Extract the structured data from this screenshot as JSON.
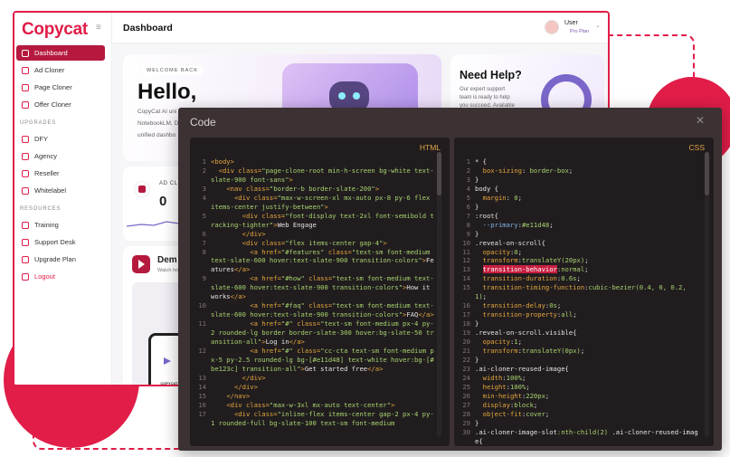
{
  "brand": {
    "name": "Copycat",
    "accent": "#e11d48",
    "active_bg": "#b51a3e"
  },
  "sidebar": {
    "items": [
      {
        "label": "Dashboard",
        "active": true
      },
      {
        "label": "Ad Cloner"
      },
      {
        "label": "Page Cloner"
      },
      {
        "label": "Offer Cloner"
      }
    ],
    "upgrades_title": "UPGRADES",
    "upgrades": [
      {
        "label": "DFY"
      },
      {
        "label": "Agency"
      },
      {
        "label": "Reseller"
      },
      {
        "label": "Whitelabel"
      }
    ],
    "resources_title": "RESOURCES",
    "resources": [
      {
        "label": "Training"
      },
      {
        "label": "Support Desk"
      },
      {
        "label": "Upgrade Plan"
      },
      {
        "label": "Logout"
      }
    ]
  },
  "header": {
    "title": "Dashboard",
    "user_name": "User",
    "user_plan": "Pro Plan"
  },
  "hero": {
    "badge": "WELCOME BACK",
    "title": "Hello,",
    "line1": "CopyCat AI uni",
    "line2": "NotebookLM, D",
    "line3": "unified dashbo"
  },
  "help": {
    "title": "Need Help?",
    "line1": "Our expert support",
    "line2": "team is ready to help",
    "line3": "you succeed. Available"
  },
  "ad_card": {
    "label": "AD CL",
    "count": "0"
  },
  "demo": {
    "title": "Dem",
    "subtitle": "Watch ho",
    "phone_brand": "COPYCAT"
  },
  "modal": {
    "title": "Code",
    "close": "✕",
    "html_label": "HTML",
    "css_label": "CSS",
    "html_lines": [
      {
        "n": "1",
        "html": "<span class='tag'>&lt;body&gt;</span>"
      },
      {
        "n": "2",
        "html": "  <span class='tag'>&lt;div</span> <span class='attr'>class=</span><span class='str'>\"page-clone-root min-h-screen bg-white text-slate-900 font-sans\"</span><span class='tag'>&gt;</span>"
      },
      {
        "n": "3",
        "html": "    <span class='tag'>&lt;nav</span> <span class='attr'>class=</span><span class='str'>\"border-b border-slate-200\"</span><span class='tag'>&gt;</span>"
      },
      {
        "n": "4",
        "html": "      <span class='tag'>&lt;div</span> <span class='attr'>class=</span><span class='str'>\"max-w-screen-xl mx-auto px-8 py-6 flex items-center justify-between\"</span><span class='tag'>&gt;</span>"
      },
      {
        "n": "5",
        "html": "        <span class='tag'>&lt;div</span> <span class='attr'>class=</span><span class='str'>\"font-display text-2xl font-semibold tracking-tighter\"</span><span class='tag'>&gt;</span><span class='txt'>Web Engage</span>"
      },
      {
        "n": "6",
        "html": "        <span class='tag'>&lt;/div&gt;</span>"
      },
      {
        "n": "7",
        "html": "        <span class='tag'>&lt;div</span> <span class='attr'>class=</span><span class='str'>\"flex items-center gap-4\"</span><span class='tag'>&gt;</span>"
      },
      {
        "n": "8",
        "html": "          <span class='tag'>&lt;a</span> <span class='attr'>href=</span><span class='str'>\"#features\"</span> <span class='attr'>class=</span><span class='str'>\"text-sm font-medium text-slate-600 hover:text-slate-900 transition-colors\"</span><span class='tag'>&gt;</span><span class='txt'>Features</span><span class='tag'>&lt;/a&gt;</span>"
      },
      {
        "n": "9",
        "html": "          <span class='tag'>&lt;a</span> <span class='attr'>href=</span><span class='str'>\"#how\"</span> <span class='attr'>class=</span><span class='str'>\"text-sm font-medium text-slate-600 hover:text-slate-900 transition-colors\"</span><span class='tag'>&gt;</span><span class='txt'>How it works</span><span class='tag'>&lt;/a&gt;</span>"
      },
      {
        "n": "10",
        "html": "          <span class='tag'>&lt;a</span> <span class='attr'>href=</span><span class='str'>\"#faq\"</span> <span class='attr'>class=</span><span class='str'>\"text-sm font-medium text-slate-600 hover:text-slate-900 transition-colors\"</span><span class='tag'>&gt;</span><span class='txt'>FAQ</span><span class='tag'>&lt;/a&gt;</span>"
      },
      {
        "n": "11",
        "html": "          <span class='tag'>&lt;a</span> <span class='attr'>href=</span><span class='str'>\"#\"</span> <span class='attr'>class=</span><span class='str'>\"text-sm font-medium px-4 py-2 rounded-lg border border-slate-300 hover:bg-slate-50 transition-all\"</span><span class='tag'>&gt;</span><span class='txt'>Log in</span><span class='tag'>&lt;/a&gt;</span>"
      },
      {
        "n": "12",
        "html": "          <span class='tag'>&lt;a</span> <span class='attr'>href=</span><span class='str'>\"#\"</span> <span class='attr'>class=</span><span class='str'>\"cc-cta text-sm font-medium px-5 py-2.5 rounded-lg bg-[#e11d48] text-white hover:bg-[#be123c] transition-all\"</span><span class='tag'>&gt;</span><span class='txt'>Get started free</span><span class='tag'>&lt;/a&gt;</span>"
      },
      {
        "n": "13",
        "html": "        <span class='tag'>&lt;/div&gt;</span>"
      },
      {
        "n": "14",
        "html": "      <span class='tag'>&lt;/div&gt;</span>"
      },
      {
        "n": "15",
        "html": "    <span class='tag'>&lt;/nav&gt;</span>"
      },
      {
        "n": "16",
        "html": "    <span class='tag'>&lt;div</span> <span class='attr'>class=</span><span class='str'>\"max-w-3xl mx-auto text-center\"</span><span class='tag'>&gt;</span>"
      },
      {
        "n": "17",
        "html": "      <span class='tag'>&lt;div</span> <span class='attr'>class=</span><span class='str'>\"inline-flex items-center gap-2 px-4 py-1 rounded-full bg-slate-100 text-sm font-medium</span>"
      }
    ],
    "css_lines": [
      {
        "n": "1",
        "html": "<span class='sel'>* {</span>"
      },
      {
        "n": "2",
        "html": "  <span class='prop'>box-sizing</span><span class='punc'>: </span><span class='val'>border-box</span><span class='punc'>;</span>"
      },
      {
        "n": "3",
        "html": "<span class='punc'>}</span>"
      },
      {
        "n": "4",
        "html": "<span class='sel'>body {</span>"
      },
      {
        "n": "5",
        "html": "  <span class='prop'>margin</span><span class='punc'>: </span><span class='val'>0</span><span class='punc'>;</span>"
      },
      {
        "n": "6",
        "html": "<span class='punc'>}</span>"
      },
      {
        "n": "7",
        "html": "<span class='sel'>:root{</span>"
      },
      {
        "n": "8",
        "html": "  <span class='var'>--primary</span><span class='punc'>:</span><span class='val'>#e11d48</span><span class='punc'>;</span>"
      },
      {
        "n": "9",
        "html": "<span class='punc'>}</span>"
      },
      {
        "n": "10",
        "html": "<span class='sel'>.reveal-on-scroll{</span>"
      },
      {
        "n": "11",
        "html": "  <span class='prop'>opacity</span><span class='punc'>:</span><span class='val'>0</span><span class='punc'>;</span>"
      },
      {
        "n": "12",
        "html": "  <span class='prop'>transform</span><span class='punc'>:</span><span class='val'>translateY(20px)</span><span class='punc'>;</span>"
      },
      {
        "n": "13",
        "html": "  <span class='hl'>transition-behavior</span><span class='punc'>:</span><span class='val'>normal</span><span class='punc'>;</span>"
      },
      {
        "n": "14",
        "html": "  <span class='prop'>transition-duration</span><span class='punc'>:</span><span class='val'>0.6s</span><span class='punc'>;</span>"
      },
      {
        "n": "15",
        "html": "  <span class='prop'>transition-timing-function</span><span class='punc'>:</span><span class='val'>cubic-bezier(0.4, 0, 0.2, 1)</span><span class='punc'>;</span>"
      },
      {
        "n": "16",
        "html": "  <span class='prop'>transition-delay</span><span class='punc'>:</span><span class='val'>0s</span><span class='punc'>;</span>"
      },
      {
        "n": "17",
        "html": "  <span class='prop'>transition-property</span><span class='punc'>:</span><span class='val'>all</span><span class='punc'>;</span>"
      },
      {
        "n": "18",
        "html": "<span class='punc'>}</span>"
      },
      {
        "n": "19",
        "html": "<span class='sel'>.reveal-on-scroll.visible{</span>"
      },
      {
        "n": "20",
        "html": "  <span class='prop'>opacity</span><span class='punc'>:</span><span class='val'>1</span><span class='punc'>;</span>"
      },
      {
        "n": "21",
        "html": "  <span class='prop'>transform</span><span class='punc'>:</span><span class='val'>translateY(0px)</span><span class='punc'>;</span>"
      },
      {
        "n": "22",
        "html": "<span class='punc'>}</span>"
      },
      {
        "n": "23",
        "html": "<span class='sel'>.ai-cloner-reused-image{</span>"
      },
      {
        "n": "24",
        "html": "  <span class='prop'>width</span><span class='punc'>:</span><span class='val'>100%</span><span class='punc'>;</span>"
      },
      {
        "n": "25",
        "html": "  <span class='prop'>height</span><span class='punc'>:</span><span class='val'>100%</span><span class='punc'>;</span>"
      },
      {
        "n": "26",
        "html": "  <span class='prop'>min-height</span><span class='punc'>:</span><span class='val'>220px</span><span class='punc'>;</span>"
      },
      {
        "n": "27",
        "html": "  <span class='prop'>display</span><span class='punc'>:</span><span class='val'>block</span><span class='punc'>;</span>"
      },
      {
        "n": "28",
        "html": "  <span class='prop'>object-fit</span><span class='punc'>:</span><span class='val'>cover</span><span class='punc'>;</span>"
      },
      {
        "n": "29",
        "html": "<span class='punc'>}</span>"
      },
      {
        "n": "30",
        "html": "<span class='sel'>.ai-cloner-image-slot</span><span class='val'>:nth-child(2)</span> <span class='sel'>.ai-cloner-reused-image{</span>"
      }
    ]
  }
}
